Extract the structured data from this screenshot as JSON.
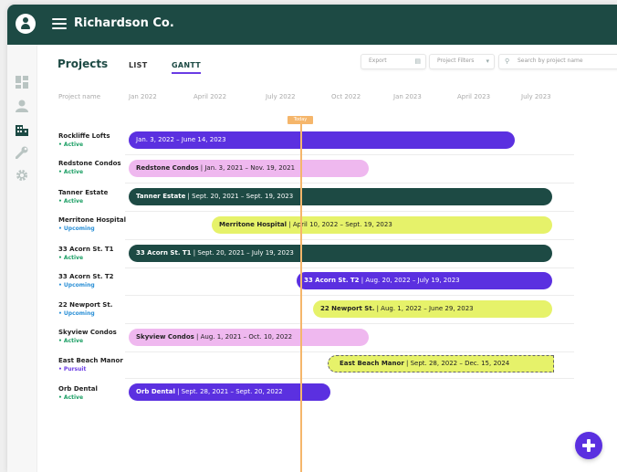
{
  "app": {
    "company": "Richardson Co."
  },
  "page": {
    "title": "Projects",
    "tabs": [
      {
        "label": "LIST"
      },
      {
        "label": "GANTT"
      }
    ]
  },
  "toolbar": {
    "export_label": "Export",
    "filters_label": "Project Filters",
    "search_placeholder": "Search by project name"
  },
  "sidebar": {
    "icons": [
      "dashboard-icon",
      "user-icon",
      "building-icon",
      "wrench-icon",
      "gear-icon"
    ]
  },
  "gantt": {
    "column_label": "Project name",
    "timeline": [
      "Jan 2022",
      "April 2022",
      "July 2022",
      "Oct 2022",
      "Jan 2023",
      "April 2023",
      "July 2023"
    ],
    "today_label": "Today",
    "status_colors": {
      "Active": "#1a9e63",
      "Upcoming": "#2a8fd6",
      "Pursuit": "#6a3be4"
    },
    "rows": [
      {
        "name": "Rockliffe Lofts",
        "status": "• Active",
        "bar_name": "",
        "bar_dates": "Jan. 3, 2022 – June 14, 2023",
        "bg": "#5b30e0",
        "fg": "#ffffff"
      },
      {
        "name": "Redstone Condos",
        "status": "• Active",
        "bar_name": "Redstone Condos",
        "bar_dates": " | Jan. 3, 2021 – Nov. 19, 2021",
        "bg": "#efb8ef",
        "fg": "#222222"
      },
      {
        "name": "Tanner Estate",
        "status": "• Active",
        "bar_name": "Tanner Estate",
        "bar_dates": " | Sept. 20, 2021 – Sept. 19, 2023",
        "bg": "#1d4a44",
        "fg": "#ffffff"
      },
      {
        "name": "Merritone Hospital",
        "status": "• Upcoming",
        "bar_name": "Merritone Hospital",
        "bar_dates": " | April 10, 2022 – Sept. 19, 2023",
        "bg": "#e6f26a",
        "fg": "#222222"
      },
      {
        "name": "33 Acorn St. T1",
        "status": "• Active",
        "bar_name": "33 Acorn St. T1",
        "bar_dates": " | Sept. 20, 2021 – July 19, 2023",
        "bg": "#1d4a44",
        "fg": "#ffffff"
      },
      {
        "name": "33 Acorn St. T2",
        "status": "• Upcoming",
        "bar_name": "33 Acorn St. T2",
        "bar_dates": " | Aug. 20, 2022 – July 19, 2023",
        "bg": "#5b30e0",
        "fg": "#ffffff"
      },
      {
        "name": "22 Newport St.",
        "status": "• Upcoming",
        "bar_name": "22 Newport St.",
        "bar_dates": " | Aug. 1, 2022 – June 29, 2023",
        "bg": "#e6f26a",
        "fg": "#222222"
      },
      {
        "name": "Skyview Condos",
        "status": "• Active",
        "bar_name": "Skyview Condos",
        "bar_dates": " | Aug. 1, 2021 – Oct. 10, 2022",
        "bg": "#efb8ef",
        "fg": "#222222"
      },
      {
        "name": "East Beach Manor",
        "status": "• Pursuit",
        "bar_name": "East Beach Manor",
        "bar_dates": " | Sept. 28, 2022 – Dec. 15, 2024",
        "bg": "#e6f26a",
        "fg": "#222222"
      },
      {
        "name": "Orb Dental",
        "status": "• Active",
        "bar_name": "Orb Dental",
        "bar_dates": " | Sept. 28, 2021 – Sept. 20, 2022",
        "bg": "#5b30e0",
        "fg": "#ffffff"
      }
    ]
  }
}
